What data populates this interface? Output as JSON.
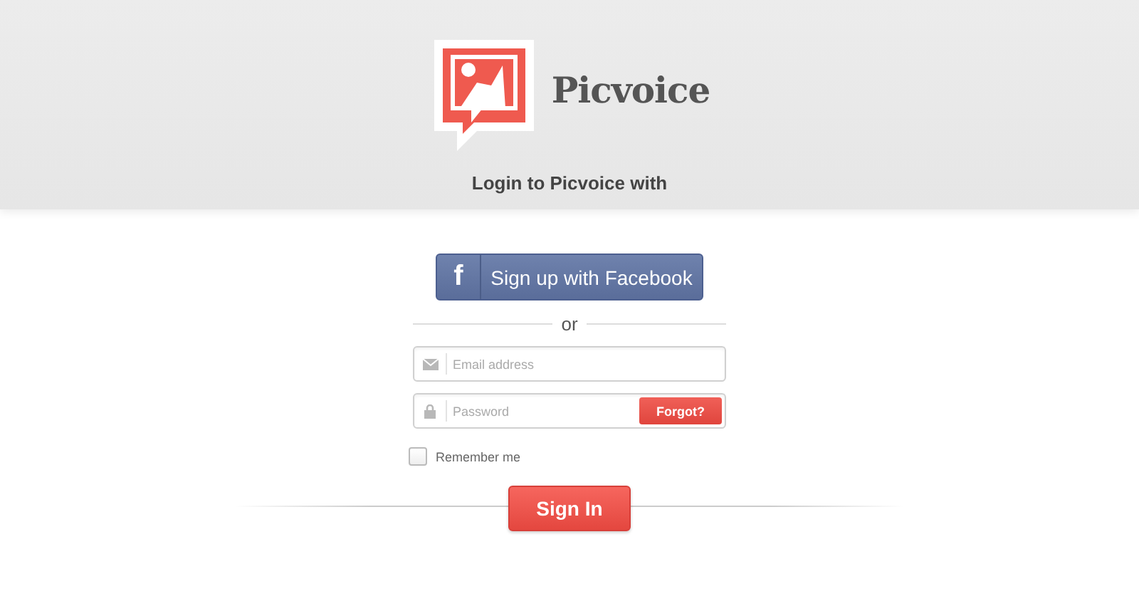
{
  "brand": {
    "name": "Picvoice"
  },
  "heading": "Login to Picvoice with",
  "facebook_button": {
    "icon": "f",
    "label": "Sign up with Facebook"
  },
  "separator": "or",
  "email_field": {
    "placeholder": "Email address"
  },
  "password_field": {
    "placeholder": "Password",
    "forgot_button": "Forgot?"
  },
  "remember_me": {
    "label": "Remember me",
    "checked": false
  },
  "sign_in_button": "Sign In"
}
